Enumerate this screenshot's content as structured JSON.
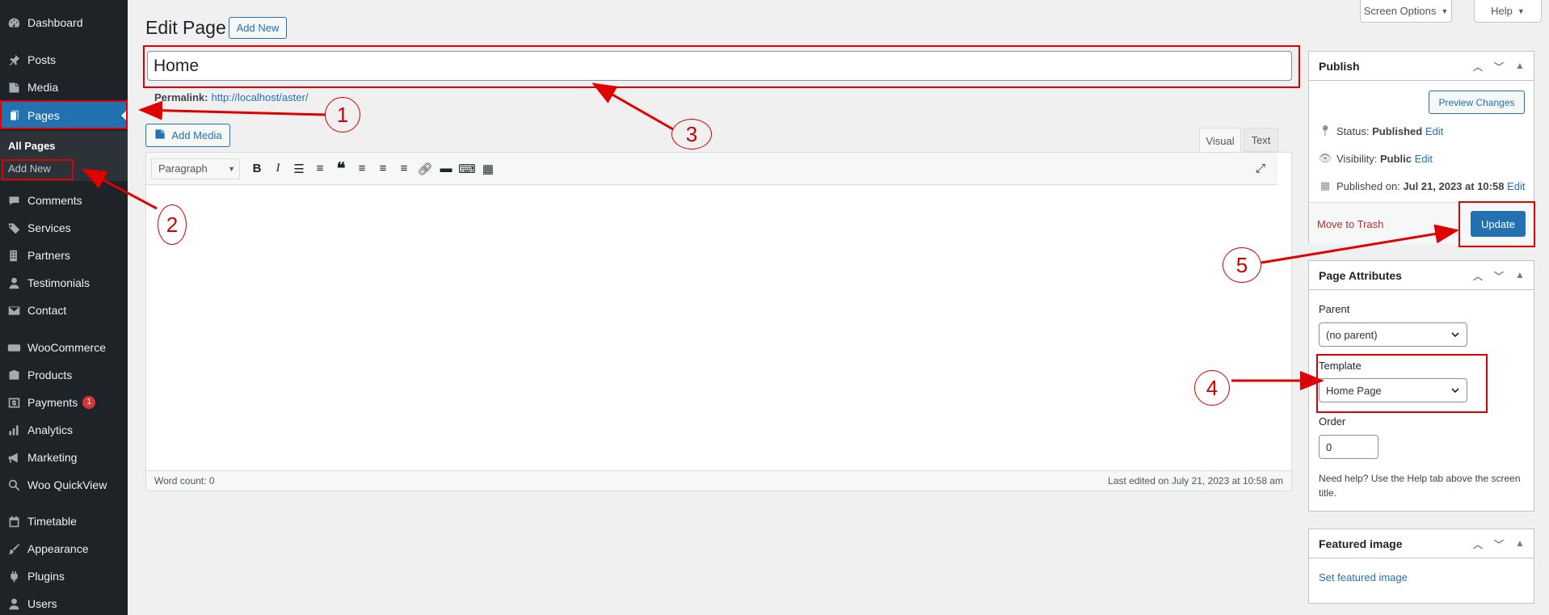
{
  "sidebar": {
    "items": [
      {
        "label": "Dashboard",
        "icon": "dashboard-icon"
      },
      {
        "label": "Posts",
        "icon": "pin-icon"
      },
      {
        "label": "Media",
        "icon": "media-icon"
      },
      {
        "label": "Pages",
        "icon": "page-icon"
      },
      {
        "label": "Comments",
        "icon": "comment-icon"
      },
      {
        "label": "Services",
        "icon": "tag-icon"
      },
      {
        "label": "Partners",
        "icon": "building-icon"
      },
      {
        "label": "Testimonials",
        "icon": "user-icon"
      },
      {
        "label": "Contact",
        "icon": "mail-icon"
      },
      {
        "label": "WooCommerce",
        "icon": "woo-icon"
      },
      {
        "label": "Products",
        "icon": "archive-icon"
      },
      {
        "label": "Payments",
        "icon": "dollar-icon",
        "badge": "1"
      },
      {
        "label": "Analytics",
        "icon": "chart-icon"
      },
      {
        "label": "Marketing",
        "icon": "megaphone-icon"
      },
      {
        "label": "Woo QuickView",
        "icon": "search-icon"
      },
      {
        "label": "Timetable",
        "icon": "calendar-icon"
      },
      {
        "label": "Appearance",
        "icon": "brush-icon"
      },
      {
        "label": "Plugins",
        "icon": "plug-icon"
      },
      {
        "label": "Users",
        "icon": "users-icon"
      }
    ],
    "submenu": {
      "all_pages": "All Pages",
      "add_new": "Add New"
    }
  },
  "top": {
    "screen_options": "Screen Options",
    "help": "Help"
  },
  "heading": {
    "title": "Edit Page",
    "add_new": "Add New"
  },
  "title_input": {
    "value": "Home"
  },
  "permalink": {
    "label": "Permalink:",
    "url": "http://localhost/aster/"
  },
  "editor": {
    "add_media": "Add Media",
    "tabs": {
      "visual": "Visual",
      "text": "Text"
    },
    "format_select": "Paragraph",
    "word_count": "Word count: 0",
    "last_edited": "Last edited on July 21, 2023 at 10:58 am"
  },
  "publish": {
    "title": "Publish",
    "preview": "Preview Changes",
    "status_label": "Status:",
    "status_value": "Published",
    "visibility_label": "Visibility:",
    "visibility_value": "Public",
    "published_label": "Published on:",
    "published_value": "Jul 21, 2023 at 10:58",
    "edit": "Edit",
    "trash": "Move to Trash",
    "update": "Update"
  },
  "attributes": {
    "title": "Page Attributes",
    "parent_label": "Parent",
    "parent_value": "(no parent)",
    "template_label": "Template",
    "template_value": "Home Page",
    "order_label": "Order",
    "order_value": "0",
    "help": "Need help? Use the Help tab above the screen title."
  },
  "featured": {
    "title": "Featured image",
    "link": "Set featured image"
  },
  "annotations": [
    "1",
    "2",
    "3",
    "4",
    "5"
  ],
  "colors": {
    "accent": "#2271b1",
    "sidebar": "#1d2327",
    "annotation": "#e00000"
  }
}
